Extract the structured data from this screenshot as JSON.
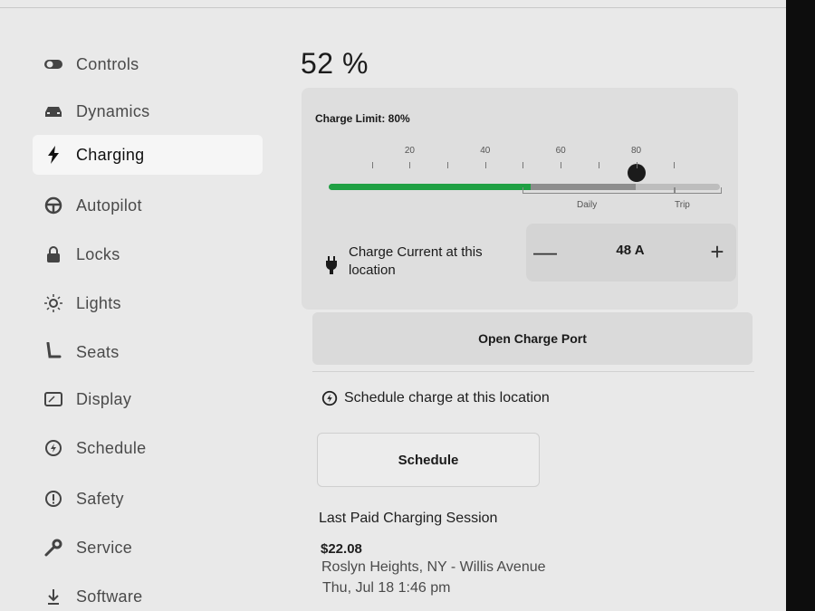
{
  "battery": {
    "percent_label": "52 %"
  },
  "sidebar": {
    "items": [
      {
        "label": "Controls",
        "icon": "toggle-icon",
        "active": false
      },
      {
        "label": "Dynamics",
        "icon": "car-icon",
        "active": false
      },
      {
        "label": "Charging",
        "icon": "lightning-icon",
        "active": true
      },
      {
        "label": "Autopilot",
        "icon": "steering-wheel-icon",
        "active": false
      },
      {
        "label": "Locks",
        "icon": "lock-icon",
        "active": false
      },
      {
        "label": "Lights",
        "icon": "light-bulb-icon",
        "active": false
      },
      {
        "label": "Seats",
        "icon": "seat-icon",
        "active": false
      },
      {
        "label": "Display",
        "icon": "display-icon",
        "active": false
      },
      {
        "label": "Schedule",
        "icon": "schedule-clock-icon",
        "active": false
      },
      {
        "label": "Safety",
        "icon": "alert-circle-icon",
        "active": false
      },
      {
        "label": "Service",
        "icon": "wrench-icon",
        "active": false
      },
      {
        "label": "Software",
        "icon": "download-icon",
        "active": false
      }
    ]
  },
  "charging": {
    "charge_limit_label": "Charge Limit: 80%",
    "charge_limit_percent": 80,
    "current_charge_percent": 52,
    "tick_labels": [
      "20",
      "40",
      "60",
      "80"
    ],
    "range_labels": {
      "daily": "Daily",
      "trip": "Trip"
    },
    "current_label": "Charge Current at this location",
    "current_value": "48 A",
    "decrement_symbol": "—",
    "increment_symbol": "+",
    "open_port_label": "Open Charge Port"
  },
  "schedule": {
    "heading": "Schedule charge at this location",
    "button_label": "Schedule"
  },
  "last_session": {
    "title": "Last Paid Charging Session",
    "amount": "$22.08",
    "location": "Roslyn Heights, NY - Willis Avenue",
    "time": "Thu, Jul 18 1:46 pm"
  },
  "colors": {
    "charge_fill": "#1fa043",
    "screen_bg": "#e9e9e9",
    "card_bg": "#dedede"
  }
}
